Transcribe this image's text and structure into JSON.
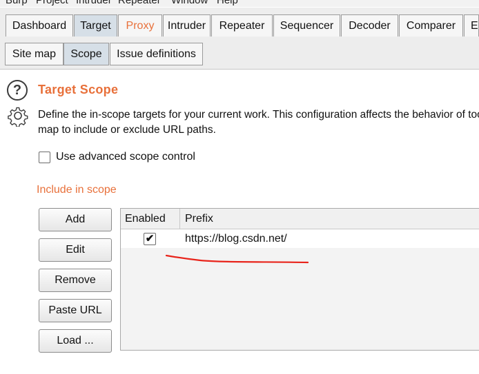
{
  "menu": [
    "Burp",
    "Project",
    "Intruder",
    "Repeater",
    "Window",
    "Help"
  ],
  "main_tabs": [
    {
      "label": "Dashboard"
    },
    {
      "label": "Target",
      "selected": true
    },
    {
      "label": "Proxy",
      "highlight_color": "#e8703a"
    },
    {
      "label": "Intruder"
    },
    {
      "label": "Repeater"
    },
    {
      "label": "Sequencer"
    },
    {
      "label": "Decoder"
    },
    {
      "label": "Comparer"
    },
    {
      "label": "E"
    }
  ],
  "sub_tabs": [
    {
      "label": "Site map"
    },
    {
      "label": "Scope",
      "selected": true
    },
    {
      "label": "Issue definitions"
    }
  ],
  "scope": {
    "title": "Target Scope",
    "description_line1": "Define the in-scope targets for your current work. This configuration affects the behavior of too",
    "description_line2": "map to include or exclude URL paths.",
    "advanced_label": "Use advanced scope control",
    "advanced_checked": false,
    "include_label": "Include in scope",
    "buttons": {
      "add": "Add",
      "edit": "Edit",
      "remove": "Remove",
      "paste_url": "Paste URL",
      "load": "Load ..."
    },
    "table": {
      "columns": [
        "Enabled",
        "Prefix"
      ],
      "rows": [
        {
          "enabled": true,
          "check_glyph": "✔",
          "prefix": "https://blog.csdn.net/"
        }
      ]
    }
  },
  "icons": {
    "help": "help-circle-icon",
    "settings": "gear-icon",
    "help_glyph": "?"
  },
  "colors": {
    "accent": "#e8703a",
    "annotation": "#e8231a",
    "selected_tab": "#d6dfe7"
  }
}
